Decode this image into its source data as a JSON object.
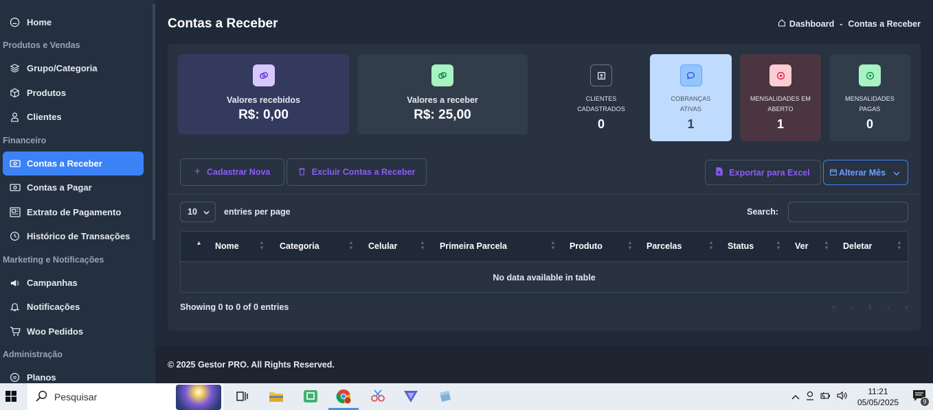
{
  "sidebar": {
    "home": "Home",
    "section_produtos": "Produtos e Vendas",
    "grupo": "Grupo/Categoria",
    "produtos": "Produtos",
    "clientes": "Clientes",
    "section_financeiro": "Financeiro",
    "contas_receber": "Contas a Receber",
    "contas_pagar": "Contas a Pagar",
    "extrato": "Extrato de Pagamento",
    "historico": "Histórico de Transações",
    "section_marketing": "Marketing e Notificações",
    "campanhas": "Campanhas",
    "notificacoes": "Notificações",
    "woo": "Woo Pedidos",
    "section_admin": "Administração",
    "planos": "Planos"
  },
  "header": {
    "title": "Contas a Receber",
    "breadcrumb_home": "Dashboard",
    "breadcrumb_sep": "-",
    "breadcrumb_current": "Contas a Receber"
  },
  "stats": {
    "recebidos_label": "Valores recebidos",
    "recebidos_value": "R$: 0,00",
    "receber_label": "Valores a receber",
    "receber_value": "R$: 25,00",
    "clientes_label_1": "CLIENTES",
    "clientes_label_2": "CADASTRADOS",
    "clientes_value": "0",
    "cobrancas_label_1": "COBRANÇAS",
    "cobrancas_label_2": "ATIVAS",
    "cobrancas_value": "1",
    "aberto_label_1": "MENSALIDADES EM",
    "aberto_label_2": "ABERTO",
    "aberto_value": "1",
    "pagas_label_1": "MENSALIDADES",
    "pagas_label_2": "PAGAS",
    "pagas_value": "0"
  },
  "actions": {
    "cadastrar": "Cadastrar Nova",
    "excluir": "Excluir Contas a Receber",
    "exportar": "Exportar para Excel",
    "alterar_mes": "Alterar Mês"
  },
  "table": {
    "entries_value": "10",
    "entries_label": "entries per page",
    "search_label": "Search:",
    "columns": [
      "Nome",
      "Categoria",
      "Celular",
      "Primeira Parcela",
      "Produto",
      "Parcelas",
      "Status",
      "Ver",
      "Deletar"
    ],
    "empty": "No data available in table",
    "showing": "Showing 0 to 0 of 0 entries",
    "pager": [
      "«",
      "‹",
      "1",
      "›",
      "»"
    ]
  },
  "footer": {
    "text": "© 2025 Gestor PRO. All Rights Reserved."
  },
  "taskbar": {
    "search": "Pesquisar",
    "time": "11:21",
    "date": "05/05/2025",
    "notifications": "9"
  },
  "colors": {
    "accent_blue": "#3b82f6",
    "accent_purple": "#8b5cf6",
    "card_recebidos": "#34395e",
    "card_cobrancas": "#bfdbfe",
    "card_aberto": "#4a3540"
  }
}
